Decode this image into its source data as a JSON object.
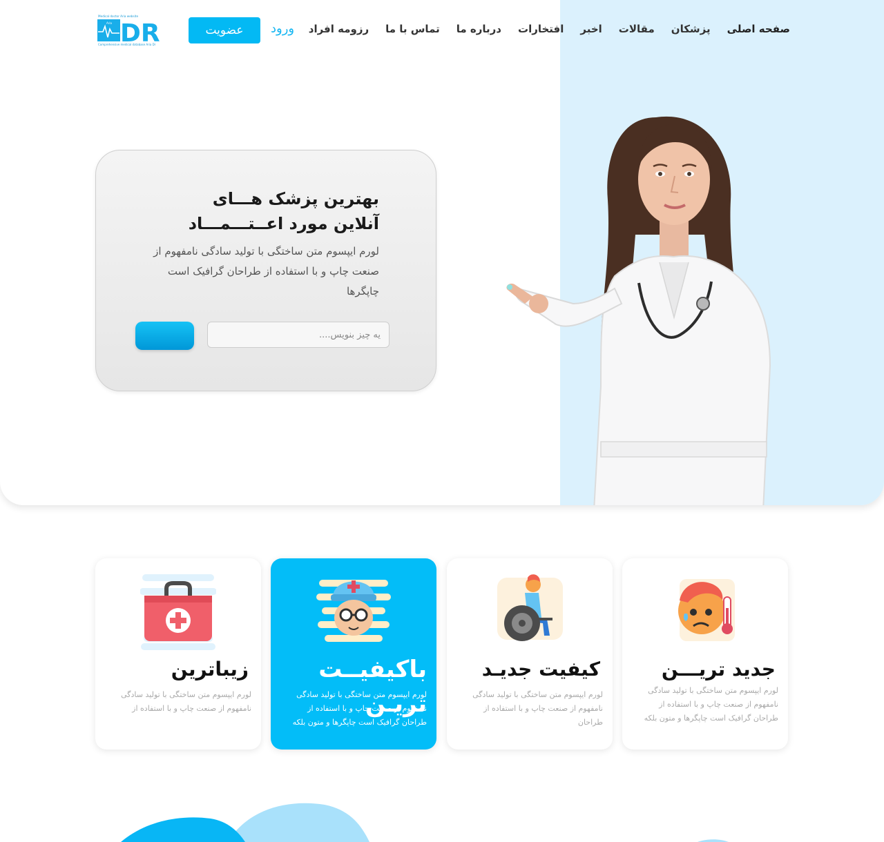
{
  "nav": {
    "items": [
      {
        "label": "صفحه اصلی",
        "name": "nav-home"
      },
      {
        "label": "پزشکان",
        "name": "nav-doctors"
      },
      {
        "label": "مقالات",
        "name": "nav-articles"
      },
      {
        "label": "اخبر",
        "name": "nav-news"
      },
      {
        "label": "افتخارات",
        "name": "nav-honors"
      },
      {
        "label": "درباره ما",
        "name": "nav-about"
      },
      {
        "label": "تماس با ما",
        "name": "nav-contact"
      },
      {
        "label": "رزومه افراد",
        "name": "nav-resumes"
      }
    ],
    "login_label": "ورود",
    "join_label": "عضویت"
  },
  "logo": {
    "letters": "DR",
    "top_caption": "Medical doctor Aria website",
    "bottom_caption": "Comprehensive medical database Aria Dr",
    "brand": "Aria"
  },
  "hero": {
    "title_line1": "بهترین پزشک هـــای",
    "title_line2": "آنلاین مورد اعــتـــمـــاد",
    "text": "لورم ایپسوم متن ساختگی با تولید سادگی نامفهوم از صنعت چاپ و با استفاده از طراحان گرافیک است چاپگرها",
    "search_placeholder": "یه چیز بنویس....",
    "image_icon": "doctor-pointing-illustration"
  },
  "features": [
    {
      "title": "جدید تریـــن",
      "text": "لورم ایپسوم متن ساختگی با تولید سادگی نامفهوم از صنعت چاپ و با استفاده از طراحان گرافیک است چاپگرها و متون بلکه",
      "icon": "sick-face-thermometer-icon"
    },
    {
      "title": "کیفیت جدیـد",
      "text": "لورم ایپسوم متن ساختگی با تولید سادگی نامفهوم از صنعت چاپ و با استفاده از طراحان",
      "icon": "wheelchair-icon"
    },
    {
      "title": "باکیفیــت تریـن",
      "text": "لورم ایپسوم متن ساختگی با تولید سادگی نامفهوم از صنعت چاپ و با استفاده از طراحان گرافیک است چاپگرها و متون بلکه",
      "icon": "doctor-face-icon"
    },
    {
      "title": "زیباترین",
      "text": "لورم ایپسوم متن ساختگی با تولید سادگی نامفهوم از صنعت چاپ و با استفاده از",
      "icon": "first-aid-kit-icon"
    }
  ],
  "colors": {
    "accent": "#03b9f4",
    "hero_panel": "#dbf1fd",
    "card_active": "#03bdf8",
    "blob_light": "#a9e1fb",
    "blob_dark": "#08b6f5"
  }
}
